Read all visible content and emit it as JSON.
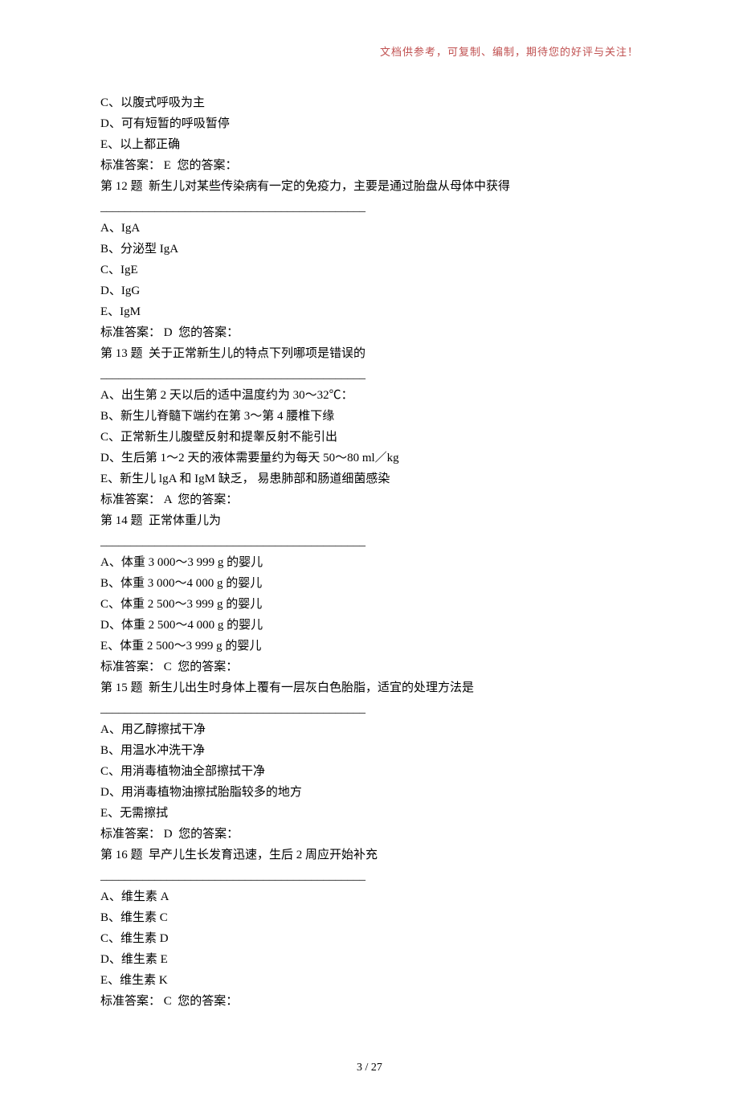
{
  "header_note": "文档供参考，可复制、编制，期待您的好评与关注！",
  "separator": "____________________________________________",
  "opt_prefix": {
    "A": "A、",
    "B": "B、",
    "C": "C、",
    "D": "D、",
    "E": "E、"
  },
  "answer_label_prefix": "标准答案： ",
  "answer_label_suffix": "  您的答案：",
  "q11_tail": {
    "opts": {
      "C": "以腹式呼吸为主",
      "D": "可有短暂的呼吸暂停",
      "E": "以上都正确"
    },
    "std": "E"
  },
  "questions": [
    {
      "num": "第 12 题",
      "text": "  新生儿对某些传染病有一定的免疫力，主要是通过胎盘从母体中获得",
      "opts": {
        "A": "IgA",
        "B": "分泌型 IgA",
        "C": "IgE",
        "D": "IgG",
        "E": "IgM"
      },
      "std": "D"
    },
    {
      "num": "第 13 题",
      "text": "  关于正常新生儿的特点下列哪项是错误的",
      "opts": {
        "A": "出生第 2 天以后的适中温度约为 30～32℃：",
        "B": "新生儿脊髓下端约在第 3～第 4 腰椎下缘",
        "C": "正常新生儿腹壁反射和提睾反射不能引出",
        "D": "生后第 1～2 天的液体需要量约为每天 50～80 ml／kg",
        "E": "新生儿 lgA 和 IgM 缺乏， 易患肺部和肠道细菌感染"
      },
      "std": "A"
    },
    {
      "num": "第 14 题",
      "text": "  正常体重儿为",
      "opts": {
        "A": "体重 3 000～3 999 g 的婴儿",
        "B": "体重 3 000～4 000 g 的婴儿",
        "C": "体重 2 500～3 999 g 的婴儿",
        "D": "体重 2 500～4 000 g 的婴儿",
        "E": "体重 2 500～3 999 g 的婴儿"
      },
      "std": "C"
    },
    {
      "num": "第 15 题",
      "text": "  新生儿出生时身体上覆有一层灰白色胎脂，适宜的处理方法是",
      "opts": {
        "A": "用乙醇擦拭干净",
        "B": "用温水冲洗干净",
        "C": "用消毒植物油全部擦拭干净",
        "D": "用消毒植物油擦拭胎脂较多的地方",
        "E": "无需擦拭"
      },
      "std": "D"
    },
    {
      "num": "第 16 题",
      "text": "  早产儿生长发育迅速，生后 2 周应开始补充",
      "opts": {
        "A": "维生素 A",
        "B": "维生素 C",
        "C": "维生素 D",
        "D": "维生素 E",
        "E": "维生素 K"
      },
      "std": "C"
    }
  ],
  "footer": "3  / 27"
}
